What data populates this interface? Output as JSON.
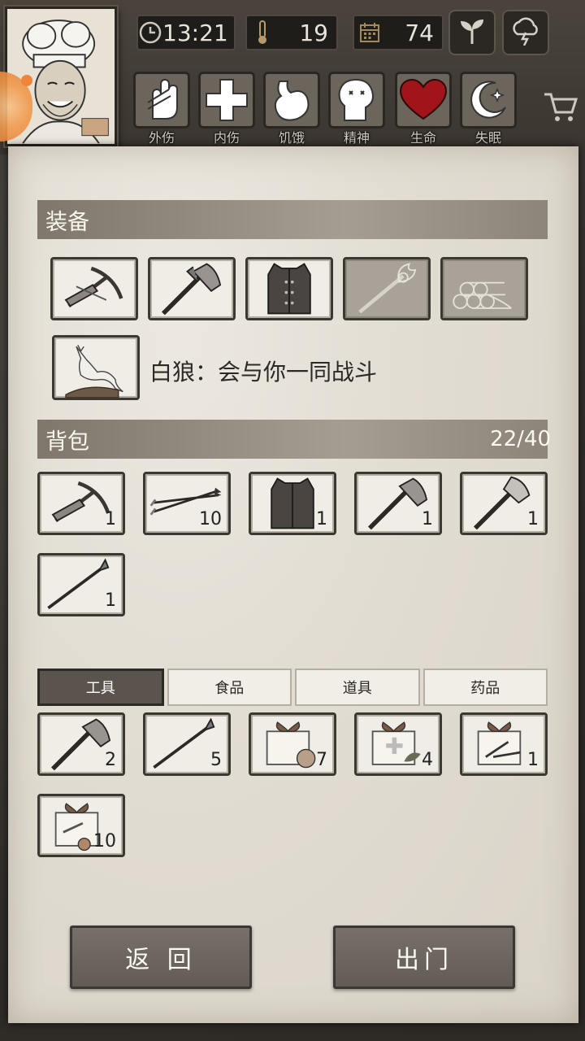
{
  "header": {
    "time": "13:21",
    "temperature": "19",
    "days": "74",
    "status": [
      {
        "label": "外伤",
        "icon": "hand-icon"
      },
      {
        "label": "内伤",
        "icon": "cross-icon"
      },
      {
        "label": "饥饿",
        "icon": "stomach-icon"
      },
      {
        "label": "精神",
        "icon": "head-icon"
      },
      {
        "label": "生命",
        "icon": "heart-icon"
      },
      {
        "label": "失眠",
        "icon": "moon-icon"
      }
    ]
  },
  "equipment": {
    "title": "装备",
    "slots": [
      {
        "icon": "crossbow-icon",
        "dim": false
      },
      {
        "icon": "axe-icon",
        "dim": false
      },
      {
        "icon": "vest-icon",
        "dim": false
      },
      {
        "icon": "torch-icon",
        "dim": true
      },
      {
        "icon": "logs-icon",
        "dim": true
      }
    ],
    "companion": {
      "icon": "wolf-icon",
      "text": "白狼：会与你一同战斗"
    }
  },
  "backpack": {
    "title": "背包",
    "count": "22/40",
    "items": [
      {
        "icon": "crossbow-icon",
        "qty": "1"
      },
      {
        "icon": "arrows-icon",
        "qty": "10"
      },
      {
        "icon": "vest-icon",
        "qty": "1"
      },
      {
        "icon": "axe-icon",
        "qty": "1"
      },
      {
        "icon": "axe-icon",
        "qty": "1"
      },
      {
        "icon": "spear-icon",
        "qty": "1"
      }
    ]
  },
  "storage": {
    "tabs": [
      "工具",
      "食品",
      "道具",
      "药品"
    ],
    "active_tab": "工具",
    "items": [
      {
        "icon": "axe-icon",
        "qty": "2"
      },
      {
        "icon": "spear-icon",
        "qty": "5"
      },
      {
        "icon": "food-box-icon",
        "qty": "7"
      },
      {
        "icon": "medicine-box-icon",
        "qty": "4"
      },
      {
        "icon": "tools-box-icon",
        "qty": "1"
      },
      {
        "icon": "wood-box-icon",
        "qty": "10"
      }
    ]
  },
  "buttons": {
    "back": "返 回",
    "go_out": "出门"
  },
  "colors": {
    "heart": "#a0141a",
    "slot_bg": "#f0ede6",
    "section_bar": "#9a9287"
  }
}
